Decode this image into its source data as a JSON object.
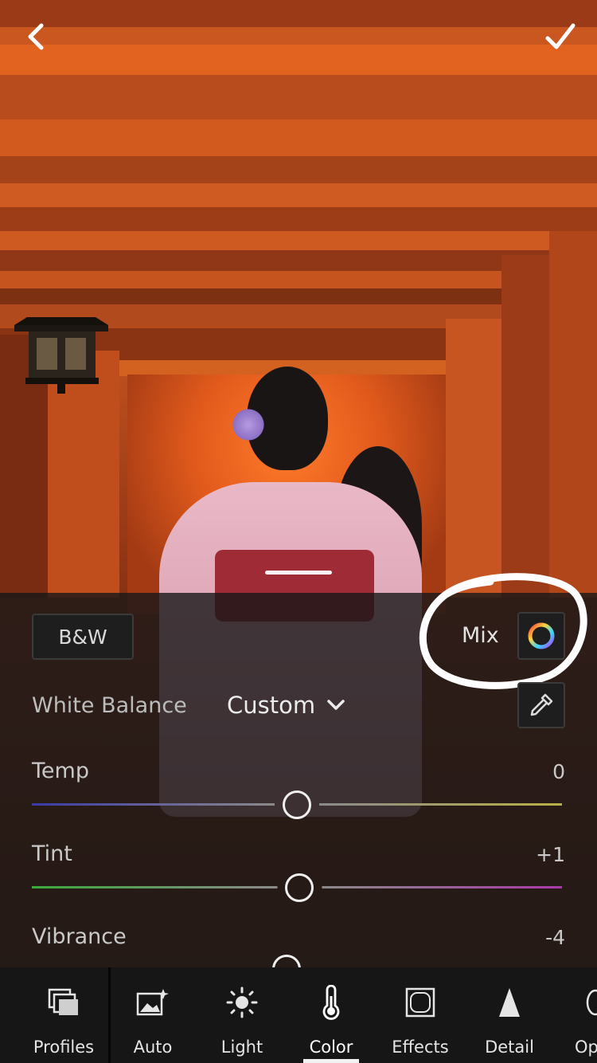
{
  "nav": {
    "back_icon": "chevron-left-icon",
    "confirm_icon": "checkmark-icon"
  },
  "panel": {
    "bw_label": "B&W",
    "mix_label": "Mix",
    "mix_icon": "color-wheel-icon",
    "white_balance": {
      "label": "White Balance",
      "value": "Custom",
      "dropdown_icon": "chevron-down-icon",
      "eyedropper_icon": "eyedropper-icon"
    },
    "sliders": [
      {
        "label": "Temp",
        "value": "0",
        "level": 0.5,
        "gradient": [
          "#3a3aa8",
          "#b9b046"
        ]
      },
      {
        "label": "Tint",
        "value": "+1",
        "level": 0.505,
        "gradient": [
          "#3aa93a",
          "#a93aa9"
        ]
      },
      {
        "label": "Vibrance",
        "value": "-4",
        "level": 0.48
      }
    ]
  },
  "toolbar": {
    "items": [
      {
        "label": "Profiles",
        "icon": "profiles-icon"
      },
      {
        "label": "Auto",
        "icon": "auto-magic-icon"
      },
      {
        "label": "Light",
        "icon": "sun-icon"
      },
      {
        "label": "Color",
        "icon": "thermometer-icon",
        "active": true
      },
      {
        "label": "Effects",
        "icon": "effects-frame-icon"
      },
      {
        "label": "Detail",
        "icon": "detail-triangle-icon"
      },
      {
        "label": "Op",
        "icon": "optics-icon"
      }
    ]
  }
}
